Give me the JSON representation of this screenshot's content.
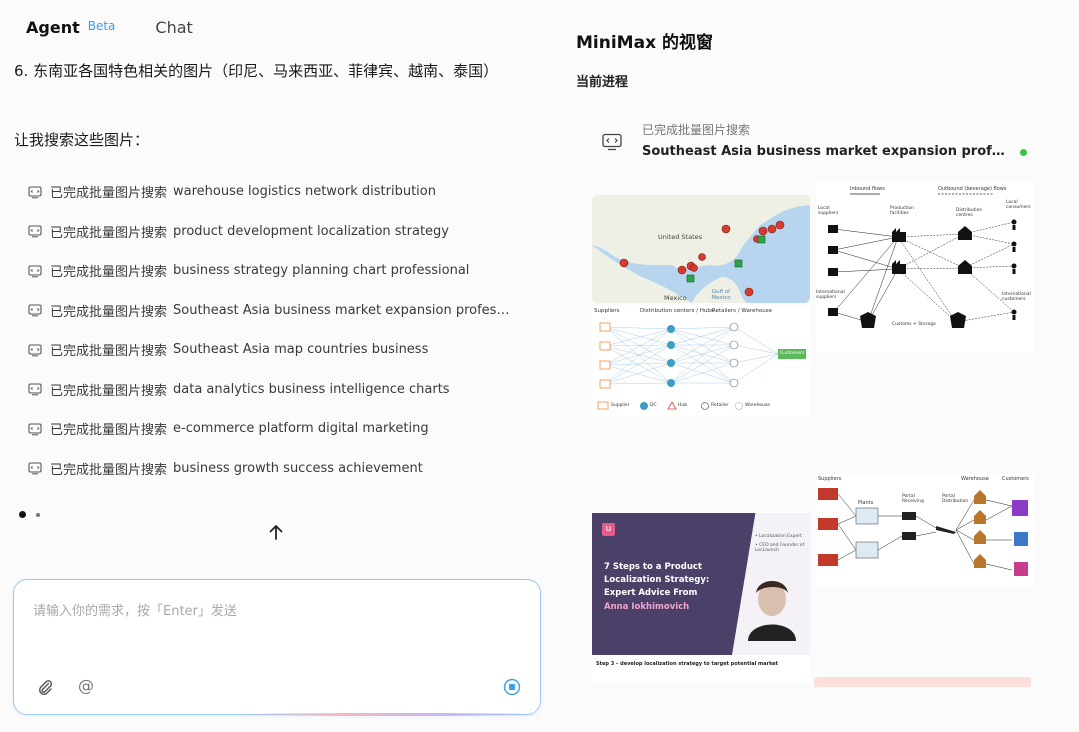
{
  "tabs": {
    "agent": "Agent",
    "beta": "Beta",
    "chat": "Chat"
  },
  "chat": {
    "message_line": "6. 东南亚各国特色相关的图片（印尼、马来西亚、菲律宾、越南、泰国）",
    "intro": "让我搜索这些图片："
  },
  "searches": [
    {
      "status": "已完成批量图片搜索",
      "query": "warehouse logistics network distribution"
    },
    {
      "status": "已完成批量图片搜索",
      "query": "product development localization strategy"
    },
    {
      "status": "已完成批量图片搜索",
      "query": "business strategy planning chart professional"
    },
    {
      "status": "已完成批量图片搜索",
      "query": "Southeast Asia business market expansion professional"
    },
    {
      "status": "已完成批量图片搜索",
      "query": "Southeast Asia map countries business"
    },
    {
      "status": "已完成批量图片搜索",
      "query": "data analytics business intelligence charts"
    },
    {
      "status": "已完成批量图片搜索",
      "query": "e-commerce platform digital marketing"
    },
    {
      "status": "已完成批量图片搜索",
      "query": "business growth success achievement"
    }
  ],
  "input": {
    "placeholder": "请输入你的需求，按「Enter」发送",
    "at_symbol": "@"
  },
  "panel": {
    "title": "MiniMax 的视窗",
    "subtitle": "当前进程",
    "process_status": "已完成批量图片搜索",
    "process_query": "Southeast Asia business market expansion professional; ..."
  },
  "thumbnails": {
    "map": {
      "country_main": "United States",
      "country_south": "Mexico",
      "gulf": "Gulf of Mexico"
    },
    "network": {
      "col_suppliers": "Suppliers",
      "col_dc": "Distribution centers / Hubs",
      "col_retail": "Retailers / Warehouse",
      "customers": "Customers",
      "legend": [
        "Supplier",
        "DC",
        "Hub",
        "Retailer",
        "Warehouse"
      ]
    },
    "flows": {
      "inbound": "Inbound flows",
      "outbound": "Outbound (beverage) flows",
      "local_suppliers": "Local suppliers",
      "production": "Production facilities",
      "distribution": "Distribution centres",
      "local_consumers": "Local consumers",
      "intl_suppliers": "International suppliers",
      "customs": "Customs + Storage",
      "intl_customers": "International customers"
    },
    "chain": {
      "suppliers": "Suppliers",
      "plants": "Plants",
      "portal1": "Portal Receiving",
      "portal2": "Portal Distribution",
      "warehouse": "Warehouse",
      "customers": "Customers"
    },
    "article": {
      "logo": "u",
      "title": "7 Steps to a Product Localization Strategy: Expert Advice From",
      "author": "Anna Iokhimovich",
      "bullets": [
        "• Localization Expert",
        "• CEO and Founder of LocLaunch"
      ],
      "caption": "Step 3 – develop localization strategy to target potential market"
    }
  },
  "colors": {
    "accent": "#3ba0e6",
    "status_dot": "#3cc24c",
    "article_bg": "#4a4068",
    "article_accent": "#f0a6d0"
  }
}
